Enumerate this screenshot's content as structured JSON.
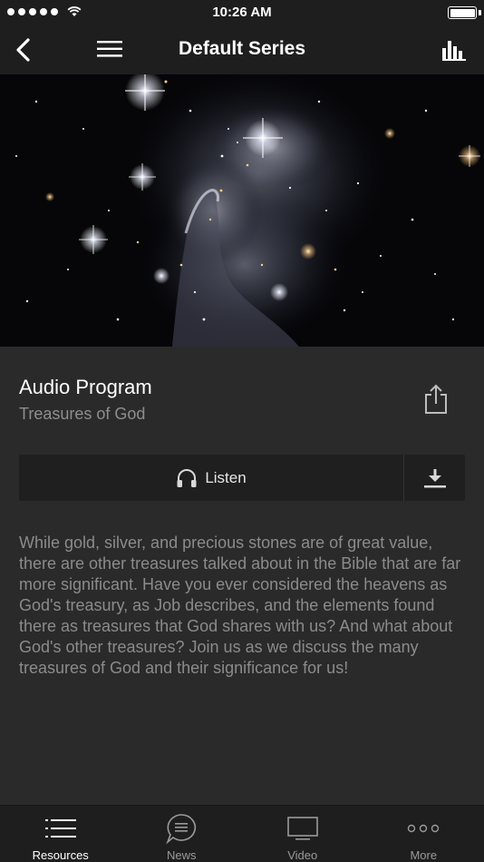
{
  "status_bar": {
    "time": "10:26 AM"
  },
  "nav": {
    "title": "Default Series"
  },
  "program": {
    "title": "Audio Program",
    "subtitle": "Treasures of God"
  },
  "actions": {
    "listen_label": "Listen"
  },
  "description": "While gold, silver, and precious stones are of great value, there are other treasures talked about in the Bible that are far more significant. Have you ever considered the heavens as God's treasury, as Job describes, and the elements found there as treasures that God shares with us? And what about God's other treasures? Join us as we discuss the many treasures of God and their significance for us!",
  "tabs": [
    {
      "label": "Resources",
      "icon": "list-icon",
      "active": true
    },
    {
      "label": "News",
      "icon": "chat-bubble-icon",
      "active": false
    },
    {
      "label": "Video",
      "icon": "tv-icon",
      "active": false
    },
    {
      "label": "More",
      "icon": "more-dots-icon",
      "active": false
    }
  ],
  "colors": {
    "background": "#2a2a2b",
    "bar": "#1e1e1e",
    "muted_text": "#8b8b8b"
  }
}
